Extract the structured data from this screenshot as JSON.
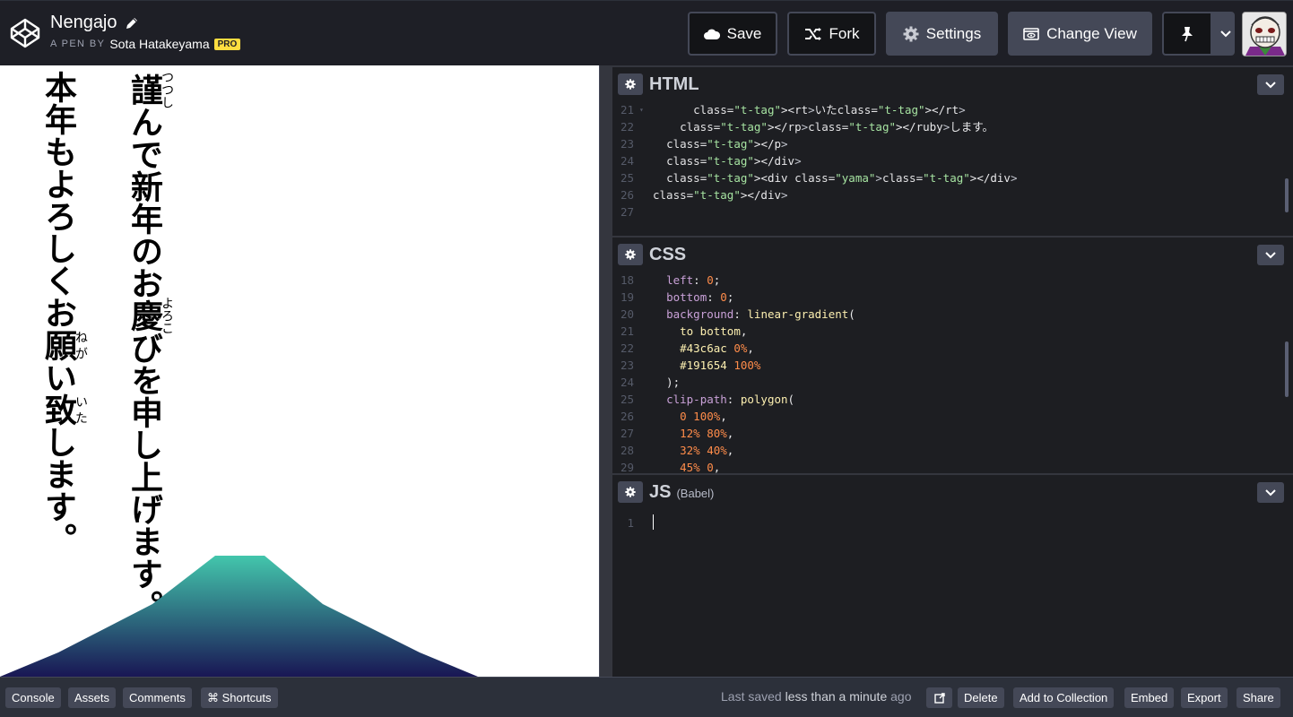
{
  "header": {
    "pen_title": "Nengajo",
    "byline_prefix": "A PEN BY",
    "author": "Sota Hatakeyama",
    "badge": "PRO",
    "buttons": {
      "save": "Save",
      "fork": "Fork",
      "settings": "Settings",
      "change_view": "Change View"
    },
    "icons": [
      "codepen-logo-icon",
      "pencil-icon",
      "cloud-icon",
      "fork-icon",
      "gear-icon",
      "view-icon",
      "pin-icon",
      "chevron-down-icon"
    ]
  },
  "preview": {
    "column1": [
      "謹",
      "つつし",
      "んで新年のお",
      "慶",
      "よろこ",
      "びを申し上げます。"
    ],
    "column2": [
      "本年もよろしくお",
      "願",
      "ねが",
      "い",
      "致",
      "いた",
      "します。"
    ],
    "mountain_colors": [
      "#43c6ac",
      "#191654"
    ]
  },
  "editors": {
    "html": {
      "title": "HTML",
      "lines": [
        {
          "n": "21",
          "fold": true,
          "code": "      <rt>いた</rt>"
        },
        {
          "n": "22",
          "code": "    </rp></ruby>します。"
        },
        {
          "n": "23",
          "code": "  </p>"
        },
        {
          "n": "24",
          "code": "  </div>"
        },
        {
          "n": "25",
          "code": "  <div class=\"yama\"></div>"
        },
        {
          "n": "26",
          "code": "</div>"
        },
        {
          "n": "27",
          "code": ""
        }
      ]
    },
    "css": {
      "title": "CSS",
      "lines": [
        {
          "n": "18",
          "code": "  left: 0;"
        },
        {
          "n": "19",
          "code": "  bottom: 0;"
        },
        {
          "n": "20",
          "code": "  background: linear-gradient("
        },
        {
          "n": "21",
          "code": "    to bottom,"
        },
        {
          "n": "22",
          "code": "    #43c6ac 0%,"
        },
        {
          "n": "23",
          "code": "    #191654 100%"
        },
        {
          "n": "24",
          "code": "  );"
        },
        {
          "n": "25",
          "code": "  clip-path: polygon("
        },
        {
          "n": "26",
          "code": "    0 100%,"
        },
        {
          "n": "27",
          "code": "    12% 80%,"
        },
        {
          "n": "28",
          "code": "    32% 40%,"
        },
        {
          "n": "29",
          "code": "    45% 0,"
        }
      ]
    },
    "js": {
      "title": "JS",
      "subtitle": "(Babel)",
      "lines": [
        {
          "n": "1",
          "code": ""
        }
      ]
    }
  },
  "footer": {
    "left_buttons": [
      "Console",
      "Assets",
      "Comments",
      "⌘ Shortcuts"
    ],
    "saved_prefix": "Last saved",
    "saved_time": "less than a minute",
    "saved_suffix": "ago",
    "right_buttons": [
      "Delete",
      "Add to Collection",
      "Embed",
      "Export",
      "Share"
    ]
  }
}
